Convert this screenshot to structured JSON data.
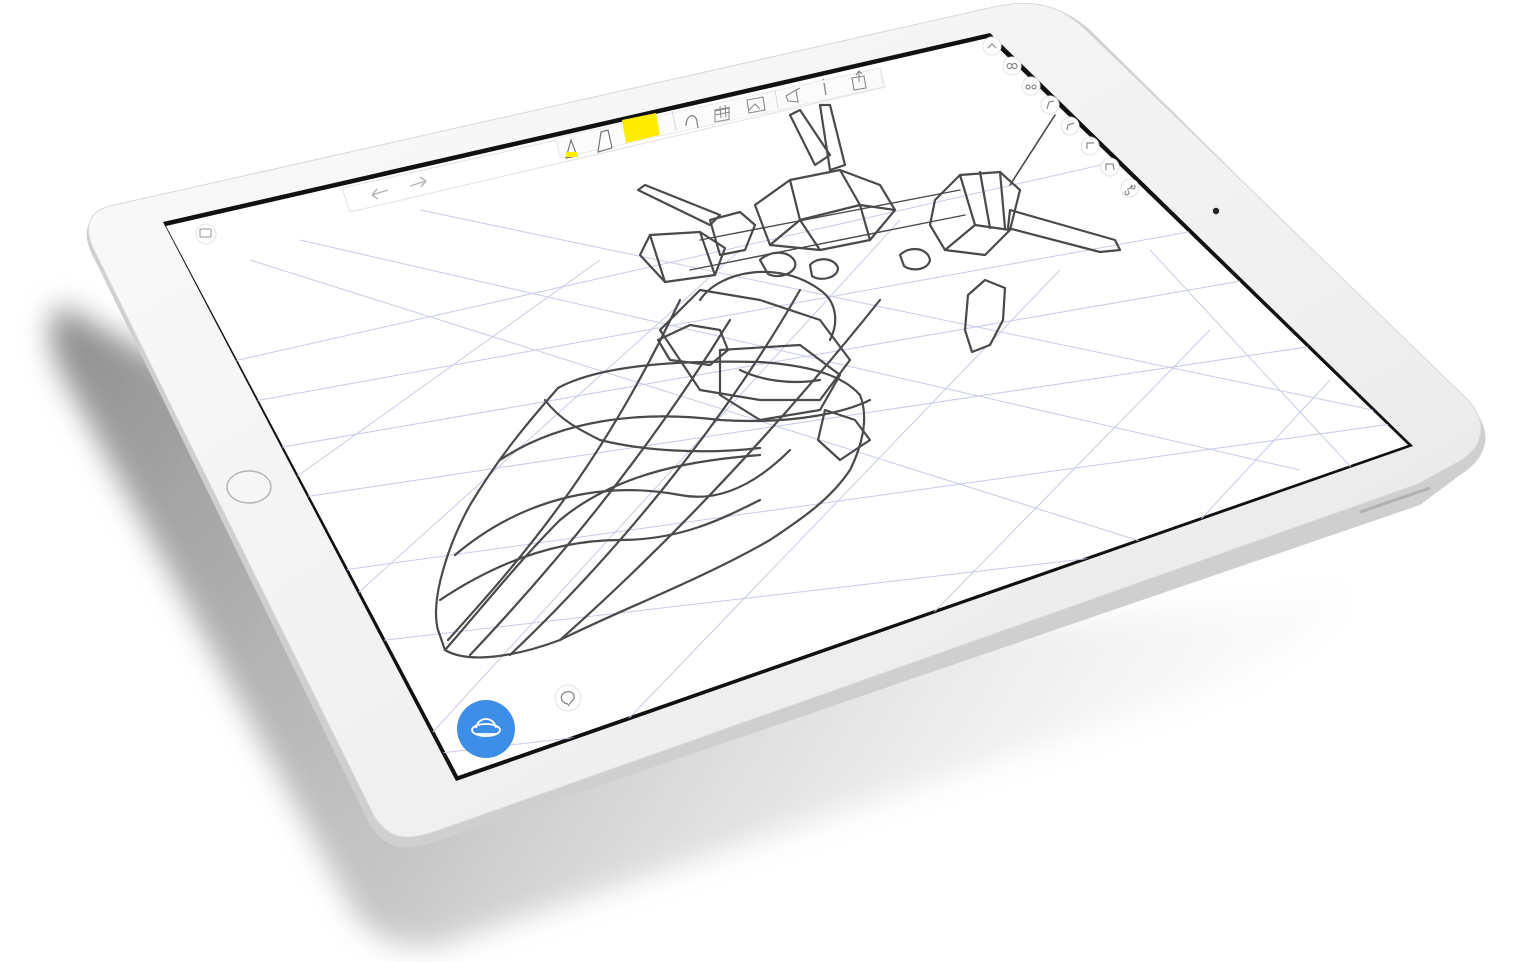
{
  "app": {
    "name": "perspective-sketch-app"
  },
  "colors": {
    "background": "#ffffff",
    "device_frame": "#f2f2f2",
    "device_edge": "#c9c9c9",
    "screen_border": "#1a1a1a",
    "canvas": "#ffffff",
    "grid_line": "#c7cbe8",
    "sketch_stroke": "#444444",
    "toolbar_bg": "#ffffff",
    "toolbar_border": "#e2e2e2",
    "highlight_swatch": "#ffec00",
    "accent_button": "#3d8ee6",
    "icon_stroke": "#8a8a8a"
  },
  "toolbar": {
    "undo_icon": "undo-arrow-icon",
    "redo_icon": "redo-arrow-icon",
    "tools": [
      {
        "icon": "pencil-icon",
        "active": true
      },
      {
        "icon": "marker-icon",
        "active": false
      },
      {
        "icon": "color-swatch",
        "color": "#ffec00"
      },
      {
        "icon": "ruler-curve-icon"
      },
      {
        "icon": "grid-icon"
      },
      {
        "icon": "image-icon"
      },
      {
        "icon": "megaphone-icon"
      },
      {
        "icon": "info-icon"
      },
      {
        "icon": "share-icon"
      }
    ]
  },
  "side_toolbar": {
    "items": [
      "collapse-chevron-icon",
      "layers-icon",
      "glasses-icon",
      "curve-tool-icon",
      "line-tool-icon",
      "rectangle-tool-icon",
      "shape-tool-icon",
      "arc-tool-icon",
      "node-tool-icon"
    ]
  },
  "canvas": {
    "top_left_button_icon": "gallery-icon",
    "lasso_button_icon": "lasso-icon",
    "perspective_button_icon": "perspective-orbit-icon"
  }
}
